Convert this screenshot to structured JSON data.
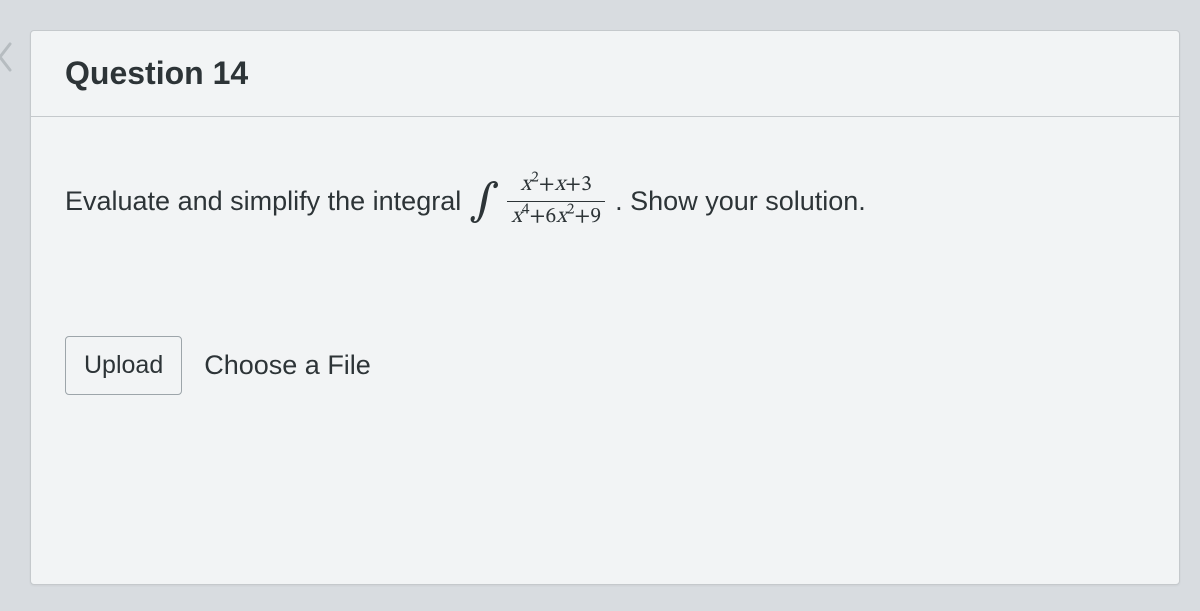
{
  "question": {
    "title": "Question 14",
    "prompt_before": "Evaluate and simplify the integral",
    "prompt_after": ".  Show your solution.",
    "integral": {
      "numerator_latex": "x^2 + x + 3",
      "denominator_latex": "x^4 + 6x^2 + 9"
    }
  },
  "upload": {
    "button_label": "Upload",
    "hint": "Choose a File"
  }
}
